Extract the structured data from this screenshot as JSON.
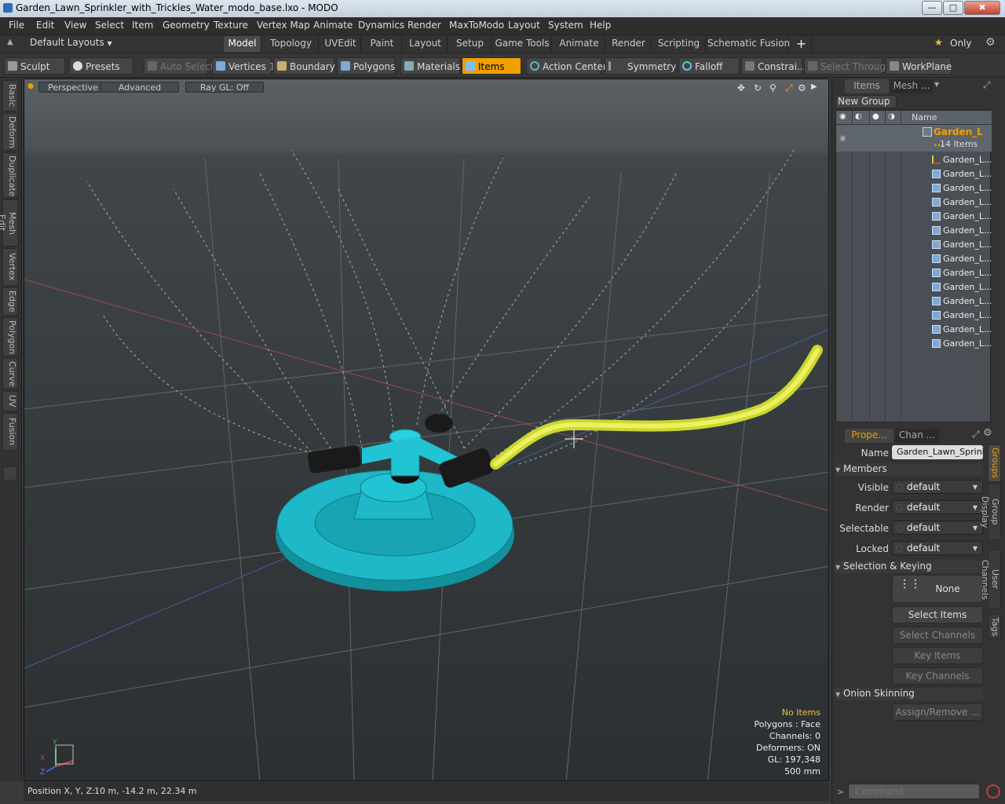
{
  "window": {
    "title": "Garden_Lawn_Sprinkler_with_Trickles_Water_modo_base.lxo - MODO",
    "minimize_glyph": "—",
    "maximize_glyph": "□",
    "close_glyph": "✖"
  },
  "menu": [
    "File",
    "Edit",
    "View",
    "Select",
    "Item",
    "Geometry",
    "Texture",
    "Vertex Map",
    "Animate",
    "Dynamics",
    "Render",
    "MaxToModo",
    "Layout",
    "System",
    "Help"
  ],
  "layouts_label": "Default Layouts",
  "mode_tabs": [
    "Model",
    "Topology",
    "UVEdit",
    "Paint",
    "Layout",
    "Setup",
    "Game Tools",
    "Animate",
    "Render",
    "Scripting",
    "Schematic Fusion"
  ],
  "mode_add": "+",
  "only_label": "Only",
  "toolbar": {
    "sculpt": "Sculpt",
    "presets": "Presets",
    "auto_select": "Auto Select",
    "vertices": "Vertices",
    "vertices_count": "1",
    "boundary": "Boundary",
    "polygons": "Polygons",
    "materials": "Materials",
    "items": "Items",
    "action_center": "Action Center",
    "symmetry": "Symmetry",
    "falloff": "Falloff",
    "constraints": "Constrai...",
    "select_through": "Select Through",
    "workplane": "WorkPlane"
  },
  "left_tabs": [
    "Basic",
    "Deform",
    "Duplicate",
    "Mesh Edit",
    "Vertex",
    "Edge",
    "Polygon",
    "Curve",
    "UV",
    "Fusion"
  ],
  "viewport": {
    "view": "Perspective",
    "shading": "Advanced",
    "raygl": "Ray GL: Off",
    "info": {
      "selection": "No Items",
      "polygons": "Polygons : Face",
      "channels": "Channels: 0",
      "deformers": "Deformers: ON",
      "gl": "GL: 197,348",
      "grid": "500 mm"
    },
    "axis": {
      "x": "X",
      "y": "Y",
      "z": "Z"
    }
  },
  "status": {
    "position_label": "Position X, Y, Z:",
    "position_value": "10 m, -14.2 m, 22.34 m"
  },
  "items_panel": {
    "tabs": [
      "Items",
      "Mesh ..."
    ],
    "new_group": "New Group",
    "name_header": "Name",
    "group_name": "Garden_L ...",
    "group_count": "14 Items",
    "children": [
      "Garden_L...",
      "Garden_L...",
      "Garden_L...",
      "Garden_L...",
      "Garden_L...",
      "Garden_L...",
      "Garden_L...",
      "Garden_L...",
      "Garden_L...",
      "Garden_L...",
      "Garden_L...",
      "Garden_L...",
      "Garden_L...",
      "Garden_L..."
    ]
  },
  "props_panel": {
    "tabs": [
      "Prope...",
      "Chan ..."
    ],
    "name_label": "Name",
    "name_value": "Garden_Lawn_Sprinkl",
    "members": "Members",
    "visible_label": "Visible",
    "visible": "default",
    "render_label": "Render",
    "render": "default",
    "selectable_label": "Selectable",
    "selectable": "default",
    "locked_label": "Locked",
    "locked": "default",
    "sel_keying": "Selection & Keying",
    "none": "None",
    "select_items": "Select Items",
    "select_channels": "Select Channels",
    "key_items": "Key Items",
    "key_channels": "Key Channels",
    "onion": "Onion Skinning",
    "assign_remove": "Assign/Remove ...",
    "side_tabs": [
      "Groups",
      "Group Display",
      "User Channels",
      "Tags"
    ]
  },
  "command_placeholder": "Command",
  "colors": {
    "accent": "#f0a000",
    "mesh": "#1fb8c8",
    "hose": "#e8f040"
  }
}
